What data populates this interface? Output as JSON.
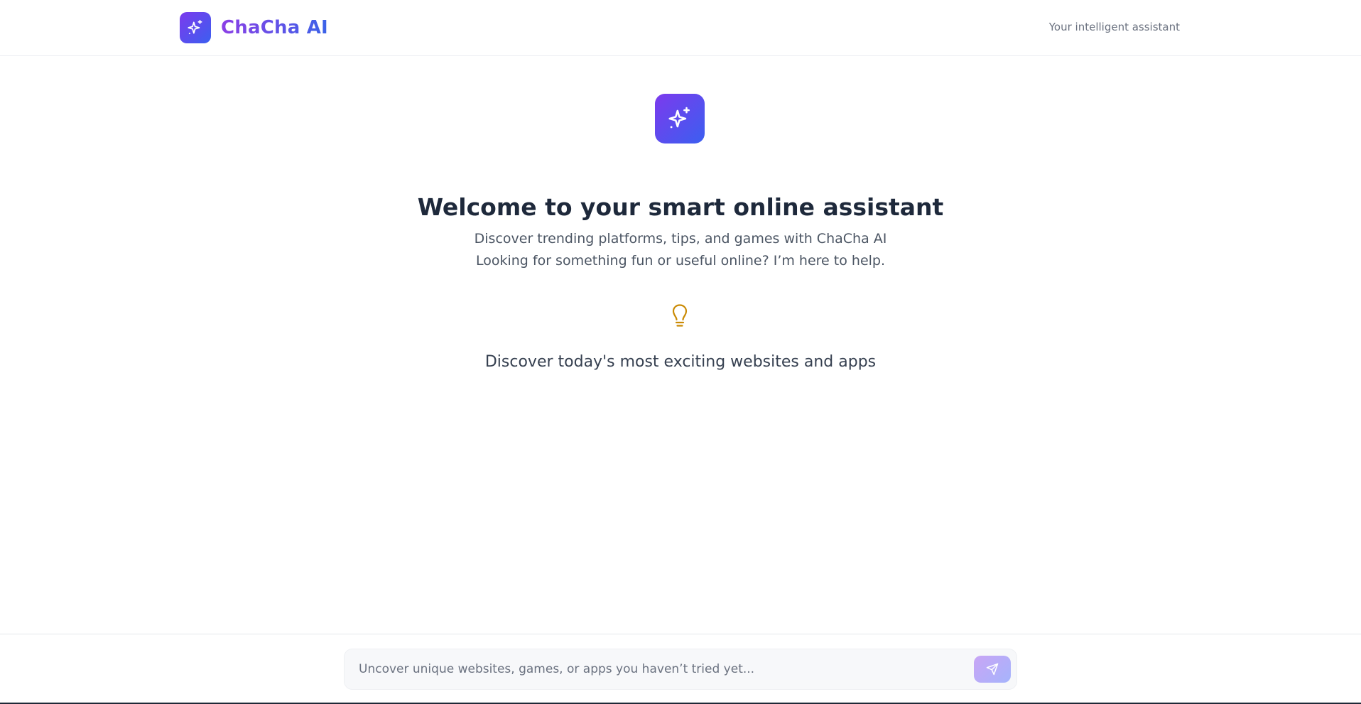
{
  "header": {
    "brand_name": "ChaCha AI",
    "tagline": "Your intelligent assistant",
    "logo_icon": "sparkles-icon"
  },
  "main": {
    "hero_icon": "sparkles-icon",
    "title": "Welcome to your smart online assistant",
    "subtitle_line1": "Discover trending platforms, tips, and games with ChaCha AI",
    "subtitle_line2": "Looking for something fun or useful online? I’m here to help.",
    "tip_icon": "lightbulb-icon",
    "tip_text": "Discover today's most exciting websites and apps"
  },
  "composer": {
    "placeholder": "Uncover unique websites, games, or apps you haven’t tried yet...",
    "value": "",
    "send_icon": "send-icon"
  },
  "colors": {
    "brand_gradient_start": "#7c3aed",
    "brand_gradient_end": "#3b5ff0",
    "tip_icon": "#ca8a04",
    "send_button_start": "#c9a5f5",
    "send_button_end": "#a5b4fc"
  }
}
